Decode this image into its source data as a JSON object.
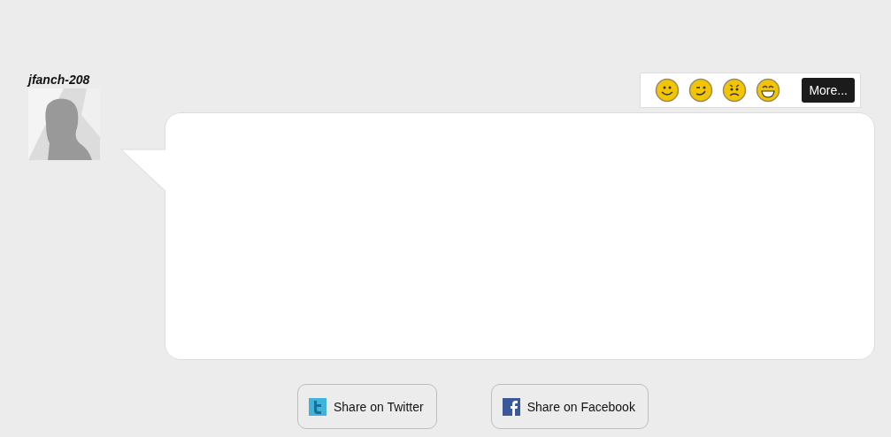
{
  "user": {
    "name": "jfanch-208"
  },
  "emoticons": [
    {
      "kind": "smile"
    },
    {
      "kind": "wink"
    },
    {
      "kind": "worried"
    },
    {
      "kind": "grin"
    }
  ],
  "more_button": {
    "label": "More..."
  },
  "share_buttons": [
    {
      "kind": "twitter",
      "label": "Share on Twitter"
    },
    {
      "kind": "facebook",
      "label": "Share on Facebook"
    }
  ]
}
